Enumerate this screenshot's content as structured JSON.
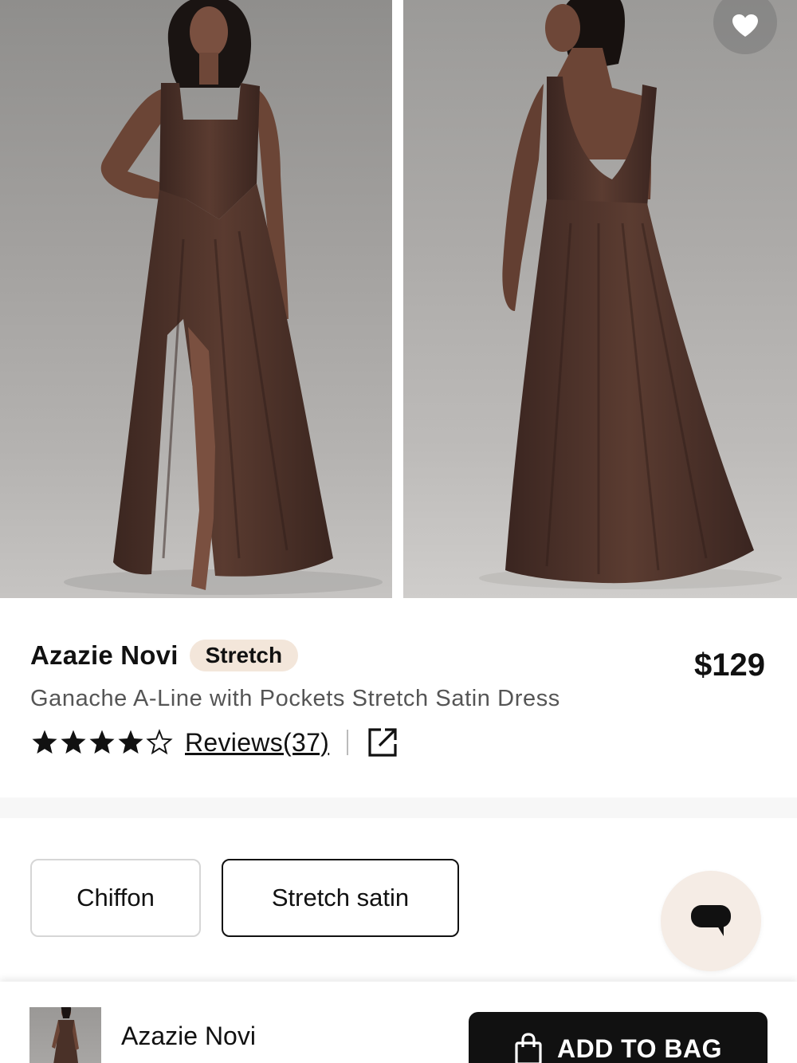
{
  "gallery": {
    "images": [
      {
        "name": "dress-front-photo"
      },
      {
        "name": "dress-back-photo"
      }
    ],
    "favorite_icon": "heart-icon"
  },
  "product": {
    "brand": "Azazie Novi",
    "badge": "Stretch",
    "price": "$129",
    "name": "Ganache A-Line with Pockets Stretch Satin Dress",
    "rating": 4,
    "rating_max": 5,
    "reviews_label": "Reviews(37)",
    "share_icon": "share-external-icon"
  },
  "fabric_options": {
    "chiffon": "Chiffon",
    "stretch_satin": "Stretch satin",
    "selected": "Stretch satin"
  },
  "chat": {
    "icon": "chat-bubble-icon"
  },
  "bottom_bar": {
    "brand": "Azazie Novi",
    "add_to_bag": "ADD TO BAG",
    "bag_icon": "shopping-bag-icon"
  },
  "colors": {
    "dress": "#4a3128",
    "badge_bg": "#f3e6da",
    "chat_bg": "#f5ece5",
    "button_bg": "#111111"
  }
}
